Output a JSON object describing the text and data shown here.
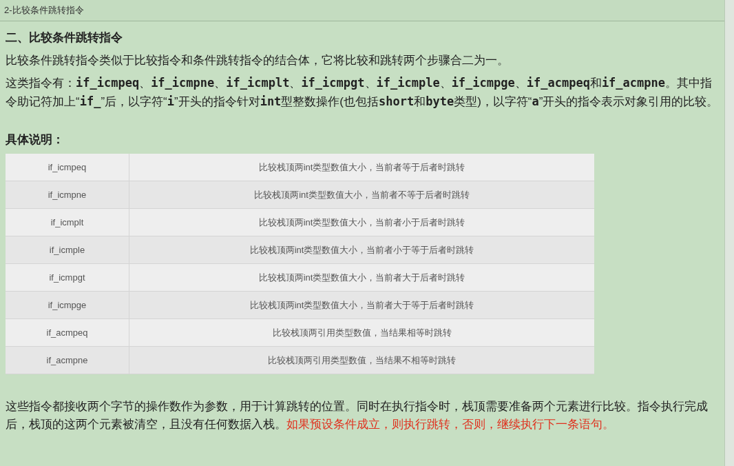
{
  "tab_title": "2-比较条件跳转指令",
  "heading": "二、比较条件跳转指令",
  "intro": "比较条件跳转指令类似于比较指令和条件跳转指令的结合体，它将比较和跳转两个步骤合二为一。",
  "description": "这类指令有：**if_icmpeq**、**if_icmpne**、**if_icmplt**、**if_icmpgt**、**if_icmple**、**if_icmpge**、**if_acmpeq**和**if_acmpne**。其中指令助记符加上“**if_**”后，以字符“**i**”开头的指令针对**int**型整数操作(也包括**short**和**byte**类型)，以字符“**a**”开头的指令表示对象引用的比较。",
  "subheading": "具体说明：",
  "table": {
    "rows": [
      {
        "instruction": "if_icmpeq",
        "meaning": "比较栈顶两int类型数值大小，当前者等于后者时跳转"
      },
      {
        "instruction": "if_icmpne",
        "meaning": "比较栈顶两int类型数值大小，当前者不等于后者时跳转"
      },
      {
        "instruction": "if_icmplt",
        "meaning": "比较栈顶两int类型数值大小，当前者小于后者时跳转"
      },
      {
        "instruction": "if_icmple",
        "meaning": "比较栈顶两int类型数值大小，当前者小于等于后者时跳转"
      },
      {
        "instruction": "if_icmpgt",
        "meaning": "比较栈顶两int类型数值大小，当前者大于后者时跳转"
      },
      {
        "instruction": "if_icmpge",
        "meaning": "比较栈顶两int类型数值大小，当前者大于等于后者时跳转"
      },
      {
        "instruction": "if_acmpeq",
        "meaning": "比较栈顶两引用类型数值，当结果相等时跳转"
      },
      {
        "instruction": "if_acmpne",
        "meaning": "比较栈顶两引用类型数值，当结果不相等时跳转"
      }
    ]
  },
  "closing": [
    {
      "kind": "normal",
      "text": "这些指令都接收两个字节的操作数作为参数，用于计算跳转的位置。同时在执行指令时，栈顶需要准备两个元素进行比较。指令执行完成后，栈顶的这两个元素被清空，且没有任何数据入栈。"
    },
    {
      "kind": "highlight",
      "text": "如果预设条件成立，则执行跳转，否则，继续执行下一条语句。"
    }
  ]
}
